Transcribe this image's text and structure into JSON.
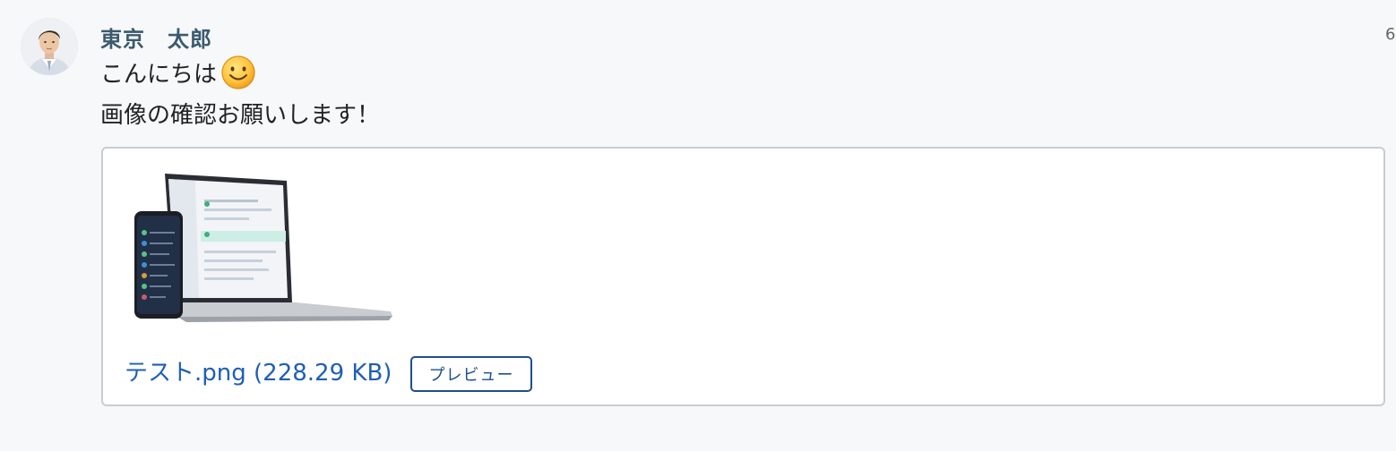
{
  "message": {
    "author": "東京　太郎",
    "timestamp": "6",
    "line1": "こんにちは",
    "line2": "画像の確認お願いします！",
    "emoji_icon": "smiling-face-emoji"
  },
  "attachment": {
    "file_label": "テスト.png (228.29 KB)",
    "preview_label": "プレビュー",
    "thumbnail_icon": "laptop-and-phone-screenshot",
    "link_color": "#1f5fb4"
  },
  "colors": {
    "author": "#3b5a6e",
    "preview_border": "#1f4e8c",
    "background": "#f7f8fa"
  }
}
